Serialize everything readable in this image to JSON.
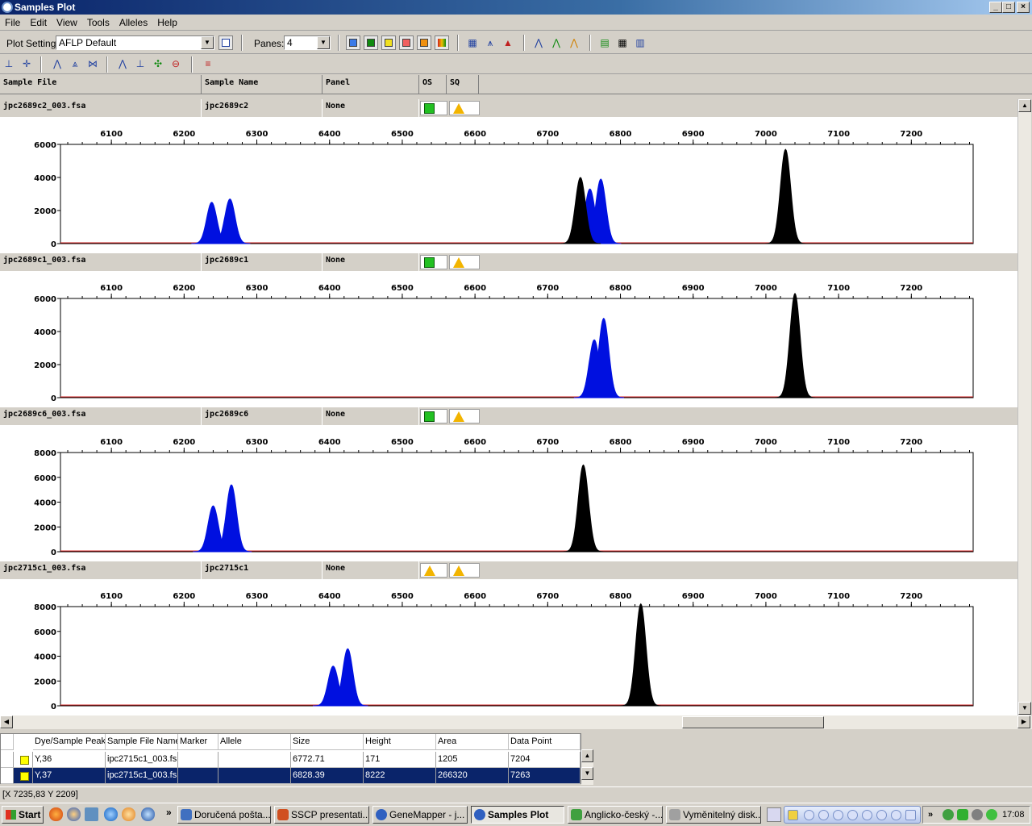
{
  "window": {
    "title": "Samples Plot",
    "buttons": [
      "_",
      "□",
      "×"
    ]
  },
  "menu": [
    "File",
    "Edit",
    "View",
    "Tools",
    "Alleles",
    "Help"
  ],
  "toolbar": {
    "plot_setting_label": "Plot Setting:",
    "plot_setting_value": "AFLP Default",
    "panes_label": "Panes:",
    "panes_value": "4",
    "dye_colors": [
      "#3a7ae8",
      "#108a10",
      "#f0e020",
      "#f06060",
      "#f09010"
    ]
  },
  "columns": {
    "sample_file": "Sample File",
    "sample_name": "Sample Name",
    "panel": "Panel",
    "os": "OS",
    "sq": "SQ"
  },
  "panes": [
    {
      "sample_file": "jpc2689c2_003.fsa",
      "sample_name": "jpc2689c2",
      "panel": "None",
      "os": "pass",
      "sq": "check"
    },
    {
      "sample_file": "jpc2689c1_003.fsa",
      "sample_name": "jpc2689c1",
      "panel": "None",
      "os": "pass",
      "sq": "check"
    },
    {
      "sample_file": "jpc2689c6_003.fsa",
      "sample_name": "jpc2689c6",
      "panel": "None",
      "os": "pass",
      "sq": "check"
    },
    {
      "sample_file": "jpc2715c1_003.fsa",
      "sample_name": "jpc2715c1",
      "panel": "None",
      "os": "check",
      "sq": "check"
    }
  ],
  "chart_data": [
    {
      "type": "area",
      "x_ticks": [
        6100,
        6200,
        6300,
        6400,
        6500,
        6600,
        6700,
        6800,
        6900,
        7000,
        7100,
        7200
      ],
      "xlim": [
        6030,
        7285
      ],
      "ylim": [
        0,
        6000
      ],
      "y_ticks": [
        0,
        2000,
        4000,
        6000
      ],
      "series": [
        {
          "color": "#0010e0",
          "peaks": [
            {
              "x": 6238,
              "y": 2500
            },
            {
              "x": 6263,
              "y": 2700
            },
            {
              "x": 6758,
              "y": 3300
            },
            {
              "x": 6773,
              "y": 3900
            }
          ]
        },
        {
          "color": "#000000",
          "peaks": [
            {
              "x": 6745,
              "y": 4000
            },
            {
              "x": 7027,
              "y": 5700
            }
          ]
        }
      ]
    },
    {
      "type": "area",
      "x_ticks": [
        6100,
        6200,
        6300,
        6400,
        6500,
        6600,
        6700,
        6800,
        6900,
        7000,
        7100,
        7200
      ],
      "xlim": [
        6030,
        7285
      ],
      "ylim": [
        0,
        6000
      ],
      "y_ticks": [
        0,
        2000,
        4000,
        6000
      ],
      "series": [
        {
          "color": "#0010e0",
          "peaks": [
            {
              "x": 6764,
              "y": 3500
            },
            {
              "x": 6777,
              "y": 4800
            }
          ]
        },
        {
          "color": "#000000",
          "peaks": [
            {
              "x": 7040,
              "y": 6300
            }
          ]
        }
      ]
    },
    {
      "type": "area",
      "x_ticks": [
        6100,
        6200,
        6300,
        6400,
        6500,
        6600,
        6700,
        6800,
        6900,
        7000,
        7100,
        7200
      ],
      "xlim": [
        6030,
        7285
      ],
      "ylim": [
        0,
        8000
      ],
      "y_ticks": [
        0,
        2000,
        4000,
        6000,
        8000
      ],
      "series": [
        {
          "color": "#0010e0",
          "peaks": [
            {
              "x": 6240,
              "y": 3700
            },
            {
              "x": 6265,
              "y": 5400
            }
          ]
        },
        {
          "color": "#000000",
          "peaks": [
            {
              "x": 6749,
              "y": 7000
            }
          ]
        }
      ]
    },
    {
      "type": "area",
      "x_ticks": [
        6100,
        6200,
        6300,
        6400,
        6500,
        6600,
        6700,
        6800,
        6900,
        7000,
        7100,
        7200
      ],
      "xlim": [
        6030,
        7285
      ],
      "ylim": [
        0,
        8000
      ],
      "y_ticks": [
        0,
        2000,
        4000,
        6000,
        8000
      ],
      "series": [
        {
          "color": "#0010e0",
          "peaks": [
            {
              "x": 6405,
              "y": 3200
            },
            {
              "x": 6425,
              "y": 4600
            }
          ]
        },
        {
          "color": "#000000",
          "peaks": [
            {
              "x": 6828,
              "y": 8222
            }
          ]
        }
      ]
    }
  ],
  "peak_table": {
    "headers": [
      "Dye/Sample Peak",
      "Sample File Name",
      "Marker",
      "Allele",
      "Size",
      "Height",
      "Area",
      "Data Point"
    ],
    "rows": [
      [
        "Y,36",
        "ipc2715c1_003.fs",
        "",
        "",
        "6772.71",
        "171",
        "1205",
        "7204"
      ],
      [
        "Y,37",
        "ipc2715c1_003.fs",
        "",
        "",
        "6828.39",
        "8222",
        "266320",
        "7263"
      ]
    ]
  },
  "status": "[X 7235,83  Y 2209]",
  "taskbar": {
    "start": "Start",
    "tasks": [
      "Doručená pošta...",
      "SSCP presentati...",
      "GeneMapper - j...",
      "Samples Plot",
      "Anglicko-český -...",
      "Vyměnitelný disk..."
    ],
    "clock": "17:08",
    "chevron": "»"
  }
}
